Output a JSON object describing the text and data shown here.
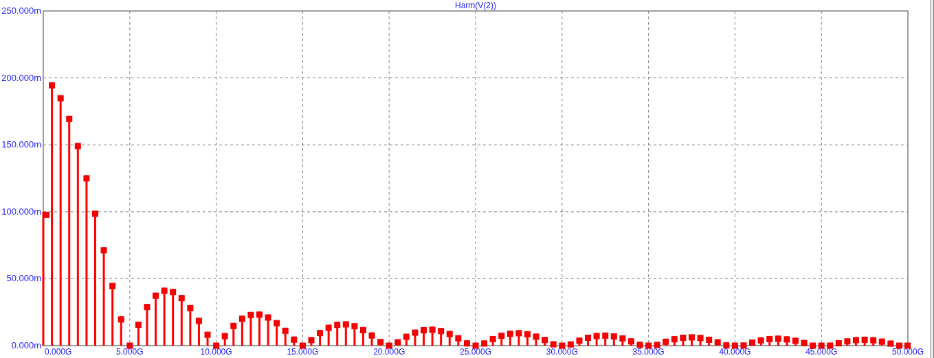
{
  "chart": {
    "chart_data": {
      "type": "bar",
      "title": "Harm(V(2))",
      "x": [
        0,
        0.5,
        1,
        1.5,
        2,
        2.5,
        3,
        3.5,
        4,
        4.5,
        5,
        5.5,
        6,
        6.5,
        7,
        7.5,
        8,
        8.5,
        9,
        9.5,
        10,
        10.5,
        11,
        11.5,
        12,
        12.5,
        13,
        13.5,
        14,
        14.5,
        15,
        15.5,
        16,
        16.5,
        17,
        17.5,
        18,
        18.5,
        19,
        19.5,
        20,
        20.5,
        21,
        21.5,
        22,
        22.5,
        23,
        23.5,
        24,
        24.5,
        25,
        25.5,
        26,
        26.5,
        27,
        27.5,
        28,
        28.5,
        29,
        29.5,
        30,
        30.5,
        31,
        31.5,
        32,
        32.5,
        33,
        33.5,
        34,
        34.5,
        35,
        35.5,
        36,
        36.5,
        37,
        37.5,
        38,
        38.5,
        39,
        39.5,
        40,
        40.5,
        41,
        41.5,
        42,
        42.5,
        43,
        43.5,
        44,
        44.5,
        45,
        45.5,
        46,
        46.5,
        47,
        47.5,
        48,
        48.5,
        49,
        49.5,
        50
      ],
      "series": [
        {
          "color": "#ff0000",
          "values": [
            100,
            196.7,
            187.1,
            171.7,
            151.4,
            127.3,
            100.9,
            73.6,
            46.8,
            21.9,
            0,
            17.9,
            31.2,
            39.6,
            43.3,
            42.4,
            37.8,
            30.3,
            20.8,
            10.4,
            0,
            9.4,
            17,
            22.4,
            25.2,
            25.5,
            23.3,
            19.1,
            13.4,
            6.8,
            0,
            6.4,
            11.7,
            15.6,
            17.8,
            18.2,
            16.8,
            13.9,
            9.9,
            5,
            0,
            4.8,
            8.9,
            12,
            13.8,
            14.2,
            13.2,
            11,
            7.8,
            4,
            0,
            3.9,
            7.2,
            9.7,
            11.2,
            11.6,
            10.8,
            9,
            6.5,
            3.3,
            0,
            3.2,
            6,
            8.2,
            9.5,
            9.8,
            9.2,
            7.7,
            5.5,
            2.9,
            0,
            2.8,
            5.2,
            7.1,
            8.2,
            8.5,
            8,
            6.7,
            4.8,
            2.5,
            0,
            2.4,
            4.6,
            6.2,
            7.2,
            7.5,
            7,
            5.9,
            4.3,
            2.2,
            0,
            2.2,
            4.1,
            5.5,
            6.4,
            6.7,
            6.3,
            5.3,
            3.8,
            2,
            0
          ]
        }
      ],
      "xlim": [
        0,
        50
      ],
      "ylim": [
        0,
        250
      ],
      "grid": true,
      "xticks": [
        {
          "value": 0,
          "label": "0.000G"
        },
        {
          "value": 5,
          "label": "5.000G"
        },
        {
          "value": 10,
          "label": "10.000G"
        },
        {
          "value": 15,
          "label": "15.000G"
        },
        {
          "value": 20,
          "label": "20.000G"
        },
        {
          "value": 25,
          "label": "25.000G"
        },
        {
          "value": 30,
          "label": "30.000G"
        },
        {
          "value": 35,
          "label": "35.000G"
        },
        {
          "value": 40,
          "label": "40.000G"
        },
        {
          "value": 45,
          "label": "45.000G"
        },
        {
          "value": 50,
          "label": "50.000G"
        }
      ],
      "yticks": [
        {
          "value": 0,
          "label": "0.000m"
        },
        {
          "value": 50,
          "label": "50.000m"
        },
        {
          "value": 100,
          "label": "100.000m"
        },
        {
          "value": 150,
          "label": "150.000m"
        },
        {
          "value": 200,
          "label": "200.000m"
        },
        {
          "value": 250,
          "label": "250.000m"
        }
      ]
    }
  }
}
